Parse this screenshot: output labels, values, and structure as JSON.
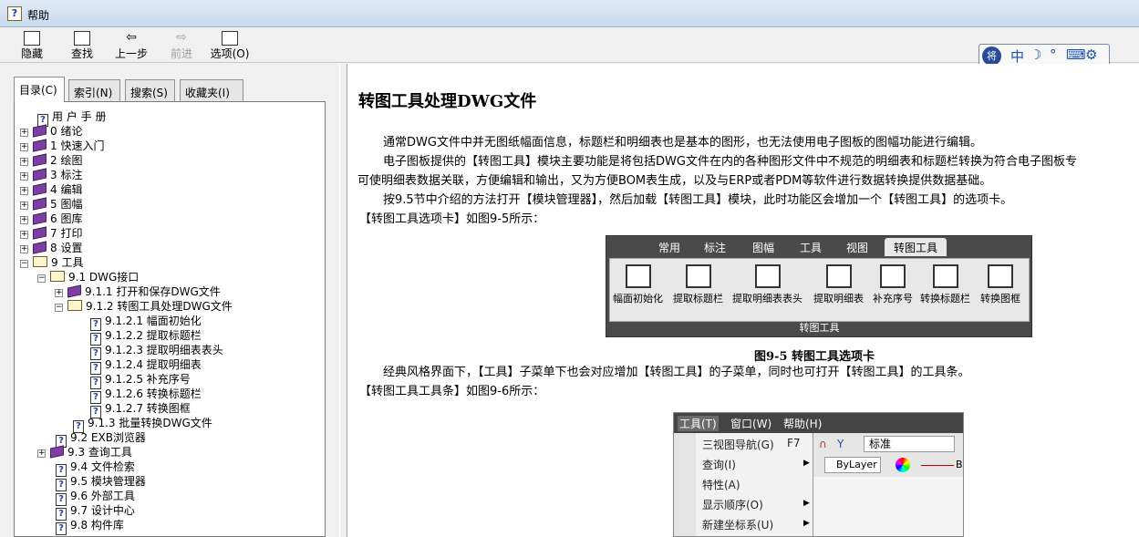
{
  "window": {
    "title": "帮助"
  },
  "toolbar": {
    "hide": "隐藏",
    "find": "查找",
    "back": "上一步",
    "forward": "前进",
    "options": "选项(O)"
  },
  "ime": {
    "logo": "将",
    "mode": "中"
  },
  "tabs": [
    {
      "label": "目录(C)"
    },
    {
      "label": "索引(N)"
    },
    {
      "label": "搜索(S)"
    },
    {
      "label": "收藏夹(I)"
    }
  ],
  "tree": [
    {
      "label": "用 户 手 册"
    },
    {
      "label": "0 绪论"
    },
    {
      "label": "1 快速入门"
    },
    {
      "label": "2 绘图"
    },
    {
      "label": "3 标注"
    },
    {
      "label": "4 编辑"
    },
    {
      "label": "5 图幅"
    },
    {
      "label": "6 图库"
    },
    {
      "label": "7 打印"
    },
    {
      "label": "8 设置"
    },
    {
      "label": "9 工具"
    },
    {
      "label": "9.1 DWG接口"
    },
    {
      "label": "9.1.1 打开和保存DWG文件"
    },
    {
      "label": "9.1.2 转图工具处理DWG文件"
    },
    {
      "label": "9.1.2.1 幅面初始化"
    },
    {
      "label": "9.1.2.2 提取标题栏"
    },
    {
      "label": "9.1.2.3 提取明细表表头"
    },
    {
      "label": "9.1.2.4 提取明细表"
    },
    {
      "label": "9.1.2.5 补充序号"
    },
    {
      "label": "9.1.2.6 转换标题栏"
    },
    {
      "label": "9.1.2.7 转换图框"
    },
    {
      "label": "9.1.3 批量转换DWG文件"
    },
    {
      "label": "9.2 EXB浏览器"
    },
    {
      "label": "9.3 查询工具"
    },
    {
      "label": "9.4 文件检索"
    },
    {
      "label": "9.5 模块管理器"
    },
    {
      "label": "9.6 外部工具"
    },
    {
      "label": "9.7 设计中心"
    },
    {
      "label": "9.8 构件库"
    }
  ],
  "content": {
    "heading": "转图工具处理DWG文件",
    "p1": "通常DWG文件中并无图纸幅面信息，标题栏和明细表也是基本的图形，也无法使用电子图板的图幅功能进行编辑。",
    "p2a": "电子图板提供的【转图工具】模块主要功能是将包括DWG文件在内的各种图形文件中不规范的明细表和标题栏转换为符合电子图板专",
    "p2b": "可使明细表数据关联，方便编辑和输出，又为方便BOM表生成，以及与ERP或者PDM等软件进行数据转换提供数据基础。",
    "p3a": "按9.5节中介绍的方法打开【模块管理器】，然后加载【转图工具】模块，此时功能区会增加一个【转图工具】的选项卡。",
    "p3b": "【转图工具选项卡】如图9-5所示：",
    "fig1_caption": "图9-5 转图工具选项卡",
    "p4a": "经典风格界面下，【工具】子菜单下也会对应增加【转图工具】的子菜单，同时也可打开【转图工具】的工具条。",
    "p4b": "【转图工具工具条】如图9-6所示："
  },
  "fig1": {
    "tabs": [
      "常用",
      "标注",
      "图幅",
      "工具",
      "视图",
      "转图工具"
    ],
    "tools": [
      "幅面初始化",
      "提取标题栏",
      "提取明细表表头",
      "提取明细表",
      "补充序号",
      "转换标题栏",
      "转换图框"
    ],
    "group": "转图工具"
  },
  "fig2": {
    "menubar": [
      "工具(T)",
      "窗口(W)",
      "帮助(H)"
    ],
    "items": [
      {
        "label": "三视图导航(G)",
        "key": "F7"
      },
      {
        "label": "查询(I)"
      },
      {
        "label": "特性(A)"
      },
      {
        "label": "显示顺序(O)"
      },
      {
        "label": "新建坐标系(U)"
      }
    ],
    "style_value": "标准",
    "layer": "ByLayer",
    "b": "B"
  }
}
